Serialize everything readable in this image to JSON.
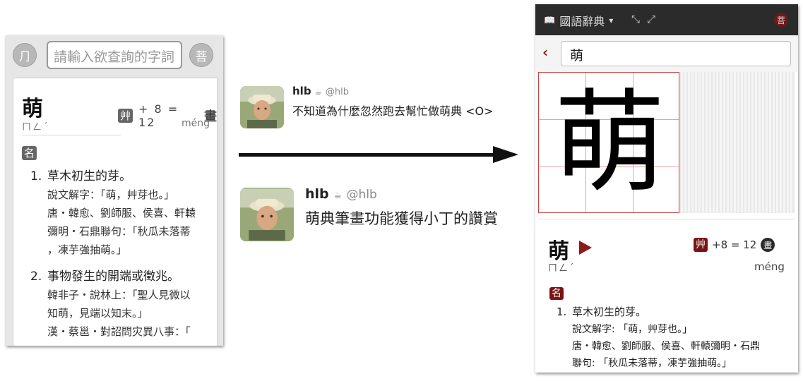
{
  "left_app": {
    "left_button_glyph": "⺆",
    "right_button_glyph": "菩",
    "search_placeholder": "請輸入欲查詢的字詞",
    "headword": "萌",
    "zhuyin": "ㄇㄥˊ",
    "radical": "艸",
    "stroke_text": "+ 8 = 12",
    "stroke_suffix": "畫",
    "pinyin": "méng",
    "pos": "名",
    "definitions": [
      {
        "num": "1.",
        "text": "草木初生的芽。",
        "examples": [
          "說文解字：「萌，艸芽也。」",
          "唐・韓愈、劉師服、侯喜、軒轅",
          "彌明・石鼎聯句：「秋瓜未落蒂",
          "，凍芋強抽萌。」"
        ]
      },
      {
        "num": "2.",
        "text": "事物發生的開端或徵兆。",
        "examples": [
          "韓非子・說林上：「聖人見微以",
          "知萌，見端以知末。」",
          "漢・蔡邕・對詔問灾異八事：「"
        ]
      }
    ]
  },
  "tweets": [
    {
      "name": "hlb",
      "icon": "☕",
      "handle": "@hlb",
      "text": "不知道為什麼忽然跑去幫忙做萌典 <O>"
    },
    {
      "name": "hlb",
      "icon": "☕",
      "handle": "@hlb",
      "text": "萌典筆畫功能獲得小丁的讚賞"
    }
  ],
  "right_app": {
    "title": "國語辭典",
    "book_icon": "📖",
    "dropdown_caret": "▾",
    "shrink_icon": "⤡",
    "expand_icon": "⤢",
    "corner_glyph": "菩",
    "back_glyph": "‹",
    "search_value": "萌",
    "big_char": "萌",
    "headword": "萌",
    "zhuyin": "ㄇㄥˊ",
    "radical": "艸",
    "stroke_text": "+8 = 12",
    "stroke_suffix": "畫",
    "pinyin": "méng",
    "pos": "名",
    "definitions": [
      {
        "num": "1.",
        "text": "草木初生的芽。",
        "examples": [
          "說文解字: 「萌，艸芽也。」",
          "唐・韓愈、劉師服、侯喜、軒轅彌明・石鼎",
          "聯句: 「秋瓜未落蒂，凍芋強抽萌。」"
        ]
      }
    ]
  },
  "colors": {
    "accent_red": "#7a1414",
    "topbar_dark": "#2b2b2b",
    "grid_line": "#e9a0a0"
  }
}
